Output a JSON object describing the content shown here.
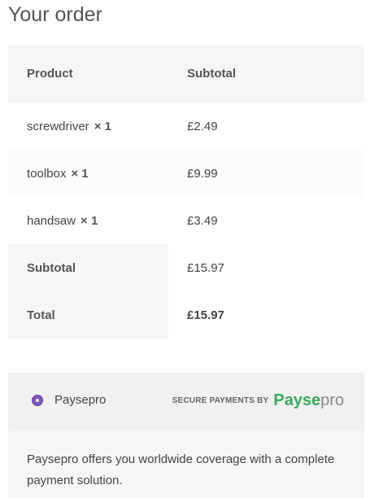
{
  "title": "Your order",
  "table": {
    "headers": {
      "product": "Product",
      "subtotal": "Subtotal"
    },
    "items": [
      {
        "name": "screwdriver",
        "qty": "× 1",
        "subtotal": "£2.49"
      },
      {
        "name": "toolbox",
        "qty": "× 1",
        "subtotal": "£9.99"
      },
      {
        "name": "handsaw",
        "qty": "× 1",
        "subtotal": "£3.49"
      }
    ],
    "footer": {
      "subtotal_label": "Subtotal",
      "subtotal_value": "£15.97",
      "total_label": "Total",
      "total_value": "£15.97"
    }
  },
  "payment": {
    "method_label": "Paysepro",
    "selected": true,
    "secure_text": "SECURE PAYMENTS BY",
    "logo_text": "Paysepro",
    "description": "Paysepro offers you worldwide coverage with a complete payment solution.",
    "radio_color": "#7e55b5",
    "brand_color": "#3aaa5c"
  }
}
